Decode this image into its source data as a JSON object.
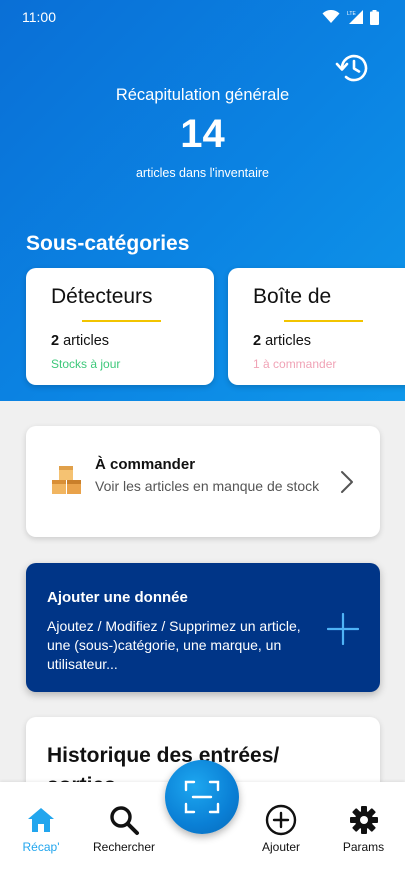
{
  "status_bar": {
    "time": "11:00",
    "icons": [
      "wifi-icon",
      "signal-lte-icon",
      "battery-icon"
    ]
  },
  "header": {
    "title": "Récapitulation générale",
    "count": "14",
    "subtitle": "articles dans l'inventaire"
  },
  "subcategories": {
    "heading": "Sous-catégories",
    "items": [
      {
        "name": "Détecteurs",
        "count_number": "2",
        "count_unit": "articles",
        "status": "Stocks à jour",
        "status_color": "#3dc87a"
      },
      {
        "name": "Boîte de",
        "count_number": "2",
        "count_unit": "articles",
        "status": "1 à commander",
        "status_color": "#f0a3b6"
      }
    ]
  },
  "order_card": {
    "title": "À commander",
    "description": "Voir les articles en manque de stock"
  },
  "add_card": {
    "title": "Ajouter une donnée",
    "description": "Ajoutez / Modifiez / Supprimez un article, une (sous-)catégorie, une marque, un utilisateur..."
  },
  "history_card": {
    "title": "Historique des entrées/ sorties"
  },
  "bottom_nav": {
    "items": [
      {
        "label": "Récap'",
        "icon": "home-icon",
        "active": true
      },
      {
        "label": "Rechercher",
        "icon": "search-icon",
        "active": false
      },
      {
        "label": "Ajouter",
        "icon": "add-circle-icon",
        "active": false
      },
      {
        "label": "Params",
        "icon": "gear-icon",
        "active": false
      }
    ],
    "fab_icon": "scan-icon"
  },
  "colors": {
    "accent": "#22a6ee",
    "header_gradient_start": "#0a6fd6",
    "add_card_bg": "#003587",
    "underline": "#f2c400"
  }
}
